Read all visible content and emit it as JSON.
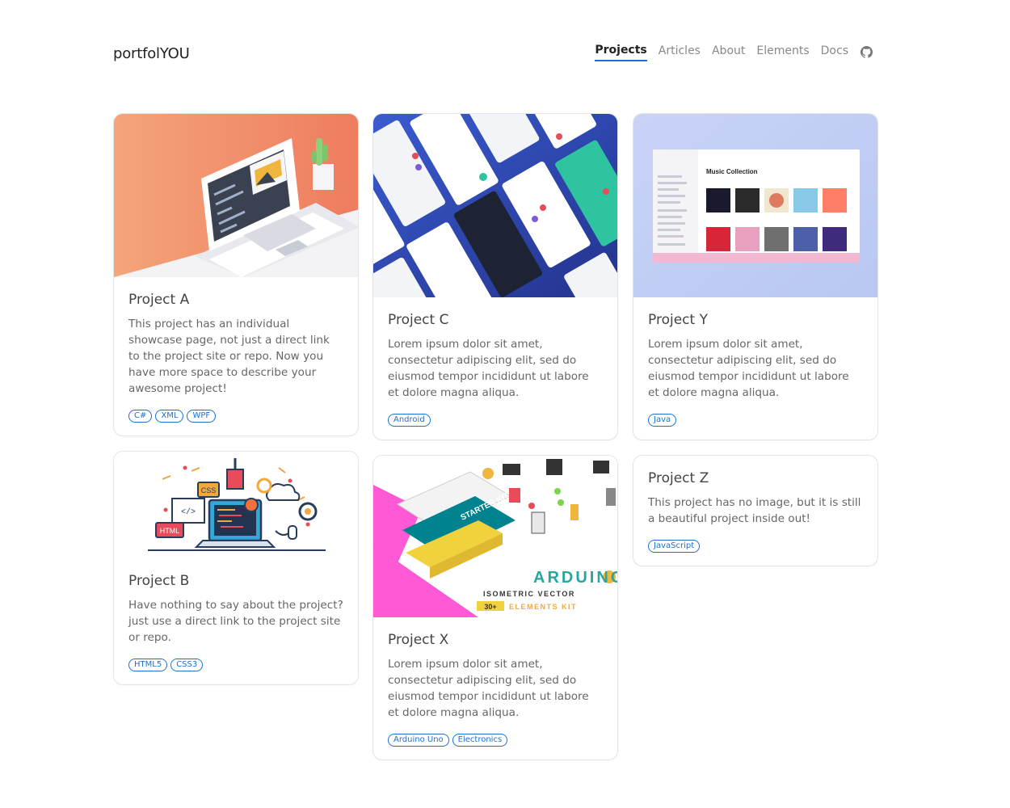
{
  "brand": "portfolYOU",
  "nav": {
    "items": [
      "Projects",
      "Articles",
      "About",
      "Elements",
      "Docs"
    ],
    "active": "Projects",
    "github_icon": "github-icon"
  },
  "colors": {
    "accent": "#1e6fd0"
  },
  "projects": {
    "a": {
      "title": "Project A",
      "description": "This project has an individual showcase page, not just a direct link to the project site or repo. Now you have more space to describe your awesome project!",
      "tags": [
        "C#",
        "XML",
        "WPF"
      ]
    },
    "b": {
      "title": "Project B",
      "description": "Have nothing to say about the project? just use a direct link to the project site or repo.",
      "tags": [
        "HTML5",
        "CSS3"
      ],
      "image_labels": [
        "CSS",
        "HTML",
        "</>"
      ]
    },
    "c": {
      "title": "Project C",
      "description": "Lorem ipsum dolor sit amet, consectetur adipiscing elit, sed do eiusmod tempor incididunt ut labore et dolore magna aliqua.",
      "tags": [
        "Android"
      ]
    },
    "x": {
      "title": "Project X",
      "description": "Lorem ipsum dolor sit amet, consectetur adipiscing elit, sed do eiusmod tempor incididunt ut labore et dolore magna aliqua.",
      "tags": [
        "Arduino Uno",
        "Electronics"
      ],
      "image_text": {
        "title": "ARDUINO",
        "subtitle": "ISOMETRIC VECTOR",
        "badge": "30+",
        "kit": "ELEMENTS KIT",
        "board": "STARTER KIT"
      }
    },
    "y": {
      "title": "Project Y",
      "description": "Lorem ipsum dolor sit amet, consectetur adipiscing elit, sed do eiusmod tempor incididunt ut labore et dolore magna aliqua.",
      "tags": [
        "Java"
      ],
      "image_text": {
        "app_title": "Music Collection"
      }
    },
    "z": {
      "title": "Project Z",
      "description": "This project has no image, but it is still a beautiful project inside out!",
      "tags": [
        "JavaScript"
      ]
    }
  }
}
